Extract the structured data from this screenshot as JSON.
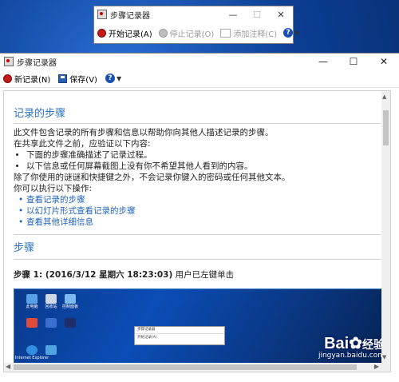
{
  "mini_window": {
    "title": "步骤记录器",
    "caption_buttons": [
      "—",
      "☐",
      "✕"
    ],
    "toolbar": {
      "start_record": "开始记录(A)",
      "stop_record": "停止记录(O)",
      "add_comment": "添加注释(C)"
    }
  },
  "main_window": {
    "title": "步骤记录器",
    "caption_buttons": [
      "—",
      "☐",
      "✕"
    ],
    "toolbar": {
      "new_record": "新记录(N)",
      "save": "保存(V)"
    }
  },
  "document": {
    "section1_title": "记录的步骤",
    "intro": "此文件包含记录的所有步骤和信息以帮助你向其他人描述记录的步骤。",
    "before_share": "在共享此文件之前，应验证以下内容:",
    "checks": [
      "下面的步骤准确描述了记录过程。",
      "以下信息或任何屏幕截图上没有你不希望其他人看到的内容。"
    ],
    "exception": "除了你使用的谜谜和快捷键之外，不会记录你键入的密码或任何其他文本。",
    "you_can": "你可以执行以下操作:",
    "links": [
      "查看记录的步骤",
      "以幻灯片形式查看记录的步骤",
      "查看其他详细信息"
    ],
    "section2_title": "步骤",
    "step1_title": "步骤 1: (2016/3/12 星期六  18:23:03)",
    "step1_desc": " 用户已左键单击"
  },
  "screenshot_icons": [
    "此电脑",
    "回收站",
    "控制面板",
    "Internet Explorer"
  ],
  "watermark": {
    "logo": "Bai",
    "logo_suffix": "经验",
    "url": "jingyan.baidu.com"
  },
  "colors": {
    "accent_blue": "#2b72c6",
    "link_blue": "#1f63b8",
    "record_red": "#c41a1a"
  }
}
